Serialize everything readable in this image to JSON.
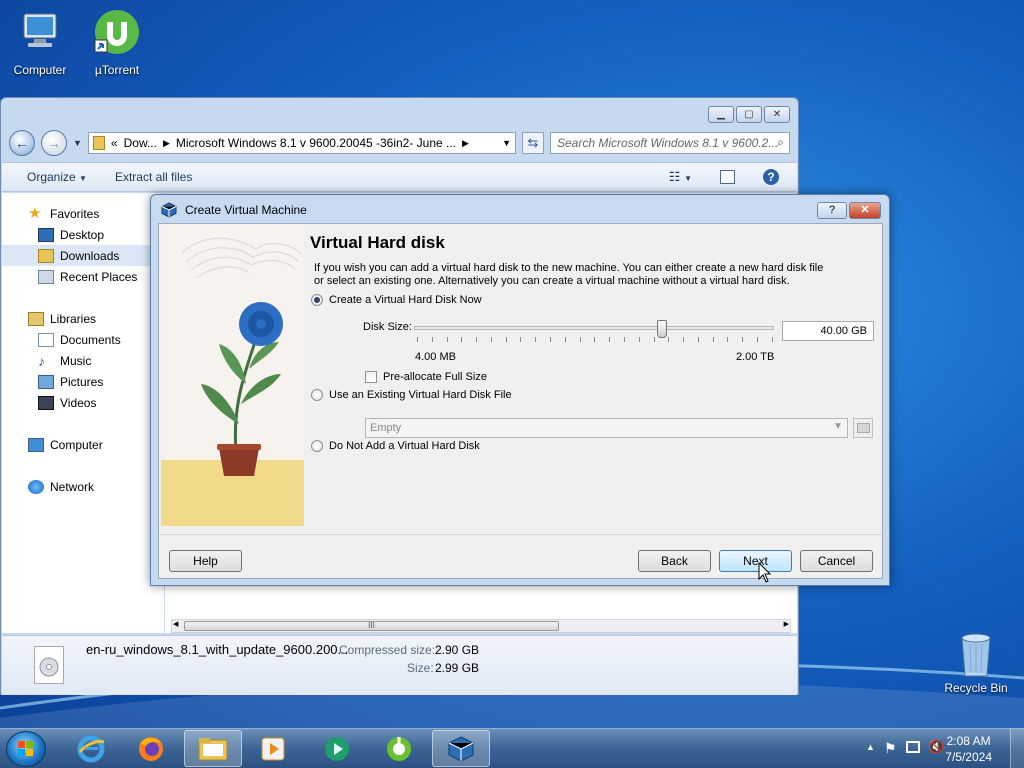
{
  "desktop": {
    "icons": [
      {
        "label": "Computer"
      },
      {
        "label": "µTorrent"
      }
    ],
    "recycle_bin": "Recycle Bin"
  },
  "explorer": {
    "address": {
      "segment1": "Dow...",
      "segment2": "Microsoft Windows 8.1 v 9600.20045 -36in2- June ..."
    },
    "search_placeholder": "Search Microsoft Windows 8.1 v 9600.2...",
    "toolbar": {
      "organize": "Organize",
      "extract_all": "Extract all files"
    },
    "nav": {
      "favorites": "Favorites",
      "desktop": "Desktop",
      "downloads": "Downloads",
      "recent_places": "Recent Places",
      "libraries": "Libraries",
      "documents": "Documents",
      "music": "Music",
      "pictures": "Pictures",
      "videos": "Videos",
      "computer": "Computer",
      "network": "Network"
    },
    "details": {
      "filename": "en-ru_windows_8.1_with_update_9600.200...",
      "compressed_label": "Compressed size:",
      "compressed_value": "2.90 GB",
      "size_label": "Size:",
      "size_value": "2.99 GB"
    },
    "scroll_grip": "III"
  },
  "dialog": {
    "title": "Create Virtual Machine",
    "help_glyph": "?",
    "close_glyph": "✕",
    "heading": "Virtual Hard disk",
    "description": "If you wish you can add a virtual hard disk to the new machine. You can either create a new hard disk file or select an existing one. Alternatively you can create a virtual machine without a virtual hard disk.",
    "option_create": "Create a Virtual Hard Disk Now",
    "disk_size_label": "Disk Size:",
    "disk_size_value": "40.00 GB",
    "disk_size_fraction": 0.69,
    "min_label": "4.00 MB",
    "max_label": "2.00 TB",
    "preallocate": "Pre-allocate Full Size",
    "option_existing": "Use an Existing Virtual Hard Disk File",
    "existing_combo": "Empty",
    "option_none": "Do Not Add a Virtual Hard Disk",
    "buttons": {
      "help": "Help",
      "back": "Back",
      "next": "Next",
      "cancel": "Cancel"
    }
  },
  "taskbar": {
    "time": "2:08 AM",
    "date": "7/5/2024"
  },
  "colors": {
    "accent": "#3c7fb1",
    "desktop": "#1460c0",
    "taskbar": "#3b6494"
  }
}
